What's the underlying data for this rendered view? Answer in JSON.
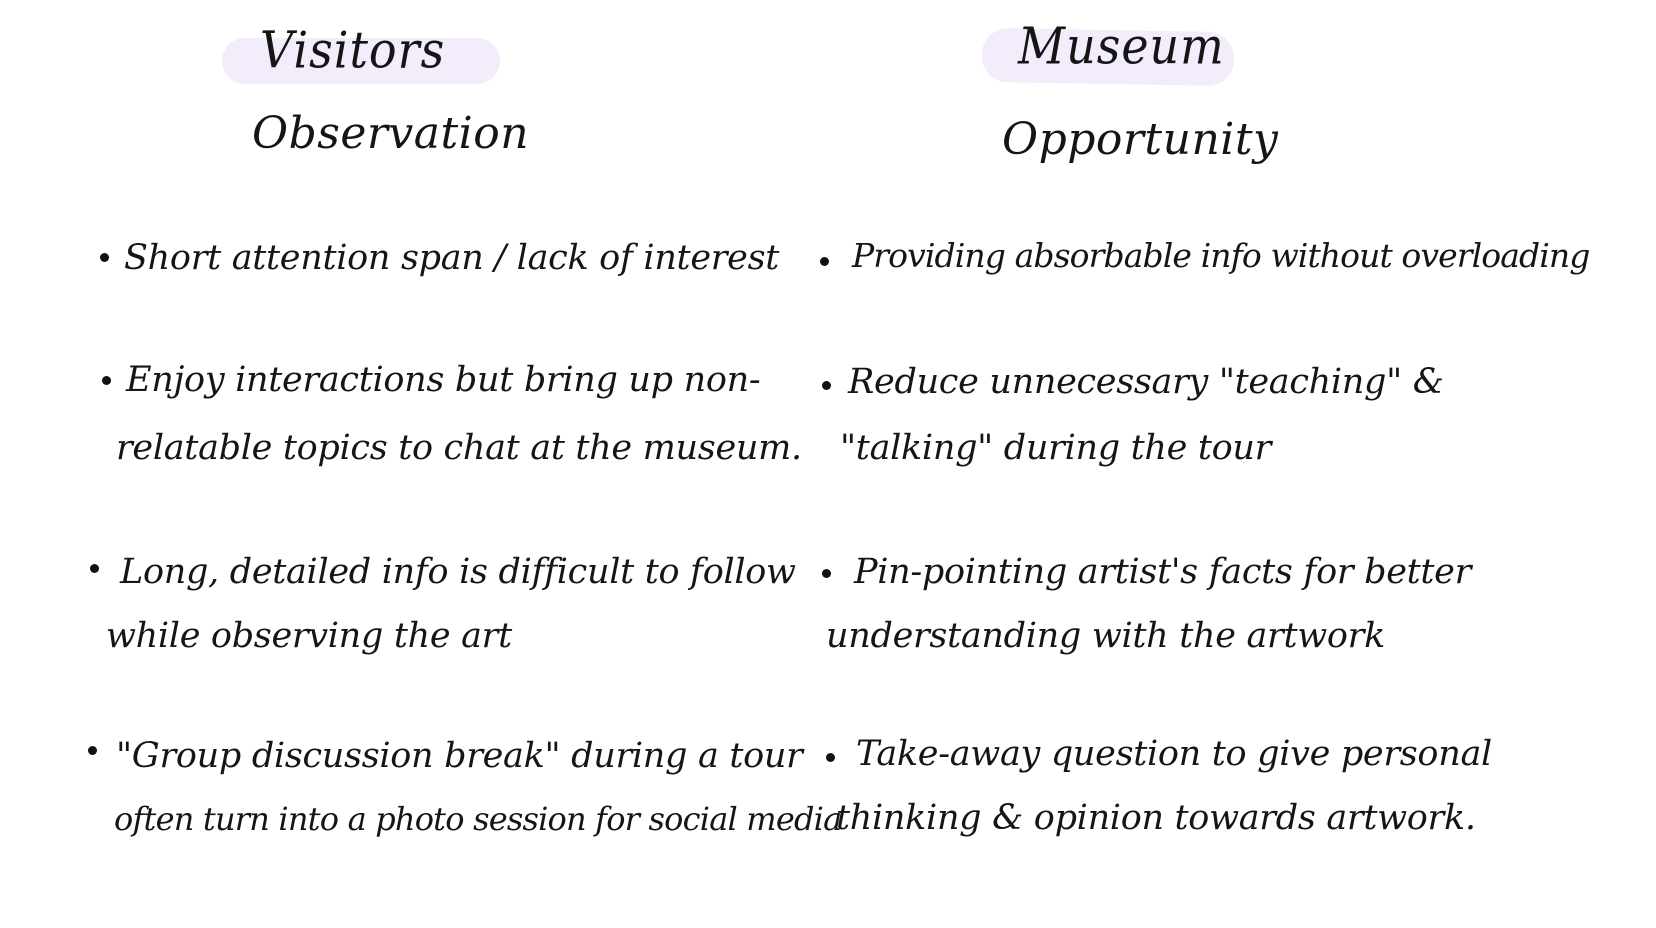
{
  "left": {
    "heading": "Visitors",
    "subheading": "Observation",
    "items": [
      {
        "line1": "Short attention span / lack of interest",
        "line2": ""
      },
      {
        "line1": "Enjoy interactions but bring up non-",
        "line2": "relatable topics to chat at the museum."
      },
      {
        "line1": "Long, detailed info is difficult to follow",
        "line2": "while observing the art"
      },
      {
        "line1": "\"Group discussion break\" during a tour",
        "line2": "often turn into a photo session for social media"
      }
    ]
  },
  "right": {
    "heading": "Museum",
    "subheading": "Opportunity",
    "items": [
      {
        "line1": "Providing absorbable info without overloading",
        "line2": ""
      },
      {
        "line1": "Reduce unnecessary \"teaching\" &",
        "line2": "\"talking\" during the tour"
      },
      {
        "line1": "Pin-pointing artist's facts for better",
        "line2": "understanding with the artwork"
      },
      {
        "line1": "Take-away question to give personal",
        "line2": "thinking & opinion towards artwork."
      }
    ]
  },
  "colors": {
    "highlight": "#f2ecfb",
    "ink": "#151515"
  }
}
